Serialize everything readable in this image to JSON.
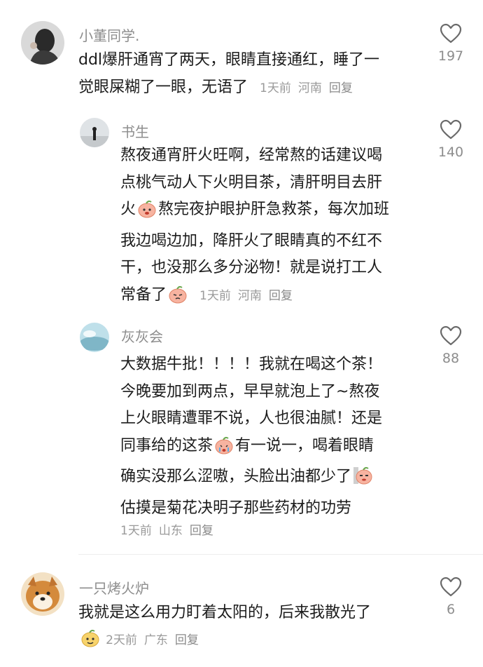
{
  "comments": [
    {
      "username": "小董同学.",
      "lines": [
        "ddl爆肝通宵了两天，眼睛直接通红，睡了一",
        "觉眼屎糊了一眼，无语了"
      ],
      "time": "1天前",
      "location": "河南",
      "reply": "回复",
      "likes": "197"
    },
    {
      "username": "书生",
      "lines": [
        "熬夜通宵肝火旺啊，经常熬的话建议喝",
        "点桃气动人下火明目茶，清肝明目去肝",
        "火",
        "熬完夜护眼护肝急救茶，每次加班",
        "我边喝边加，降肝火了眼睛真的不红不",
        "干，也没那么多分泌物！就是说打工人",
        "常备了"
      ],
      "time": "1天前",
      "location": "河南",
      "reply": "回复",
      "likes": "140"
    },
    {
      "username": "灰灰会",
      "lines": [
        "大数据牛批！！！！我就在喝这个茶！",
        "今晚要加到两点，早早就泡上了~熬夜",
        "上火眼睛遭罪不说，人也很油腻！还是",
        "同事给的这茶",
        "有一说一，喝着眼睛",
        "确实没那么涩嗷，头脸出油都少了",
        "估摸是菊花决明子那些药材的功劳"
      ],
      "time": "1天前",
      "location": "山东",
      "reply": "回复",
      "likes": "88"
    },
    {
      "username": "一只烤火炉",
      "lines": [
        "我就是这么用力盯着太阳的，后来我散光了"
      ],
      "time": "2天前",
      "location": "广东",
      "reply": "回复",
      "likes": "6"
    }
  ],
  "colors": {
    "username": "#8d8d8d",
    "text": "#1c1c1c",
    "meta": "#9a9a9a",
    "emoji": "#f4a38f"
  },
  "icons": [
    "heart-outline-icon",
    "peach-emoji-icon"
  ]
}
